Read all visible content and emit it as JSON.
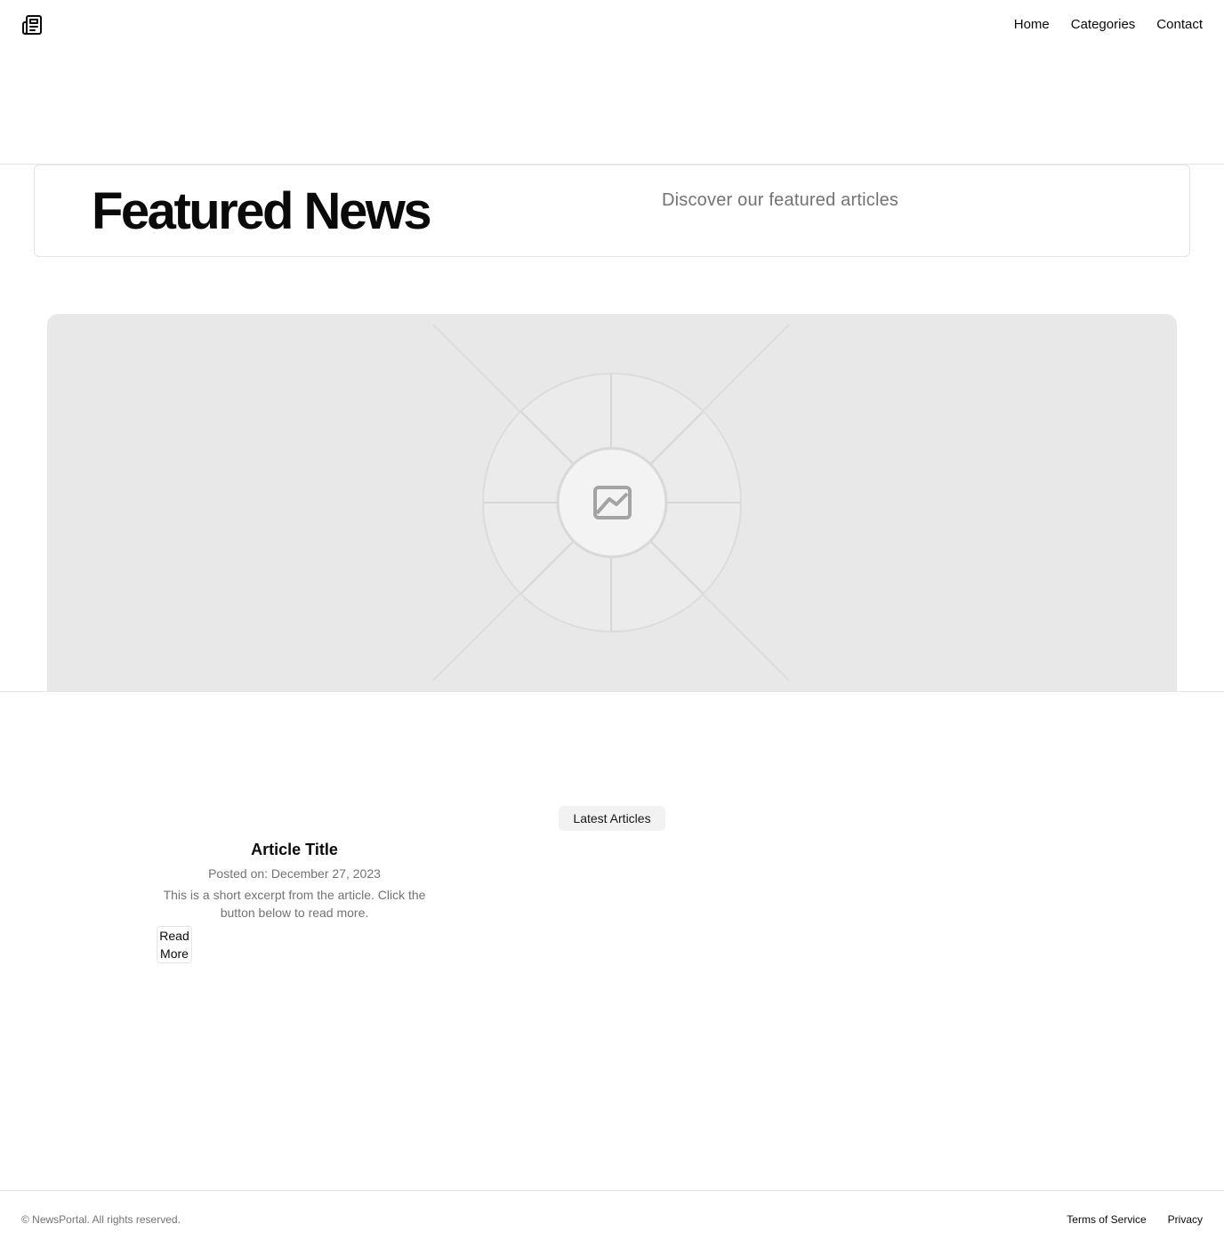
{
  "nav": {
    "logo_icon": "newspaper-icon",
    "items": [
      {
        "label": "Home"
      },
      {
        "label": "Categories"
      },
      {
        "label": "Contact"
      }
    ]
  },
  "hero": {
    "title": "Featured News",
    "subtitle": "Discover our featured articles"
  },
  "media": {
    "icon": "image-placeholder-icon"
  },
  "latest": {
    "badge": "Latest Articles",
    "articles": [
      {
        "title": "Article Title",
        "date": "Posted on: December 27, 2023",
        "excerpt": "This is a short excerpt from the article. Click the button below to read more.",
        "button_line1": "Read",
        "button_line2": "More"
      }
    ]
  },
  "footer": {
    "copyright": "© NewsPortal. All rights reserved.",
    "links": [
      {
        "label": "Terms of Service"
      },
      {
        "label": "Privacy"
      }
    ]
  },
  "colors": {
    "text": "#0a0a0a",
    "muted": "#737373",
    "border": "#e5e5e5",
    "placeholder_bg": "#e8e8e8"
  }
}
